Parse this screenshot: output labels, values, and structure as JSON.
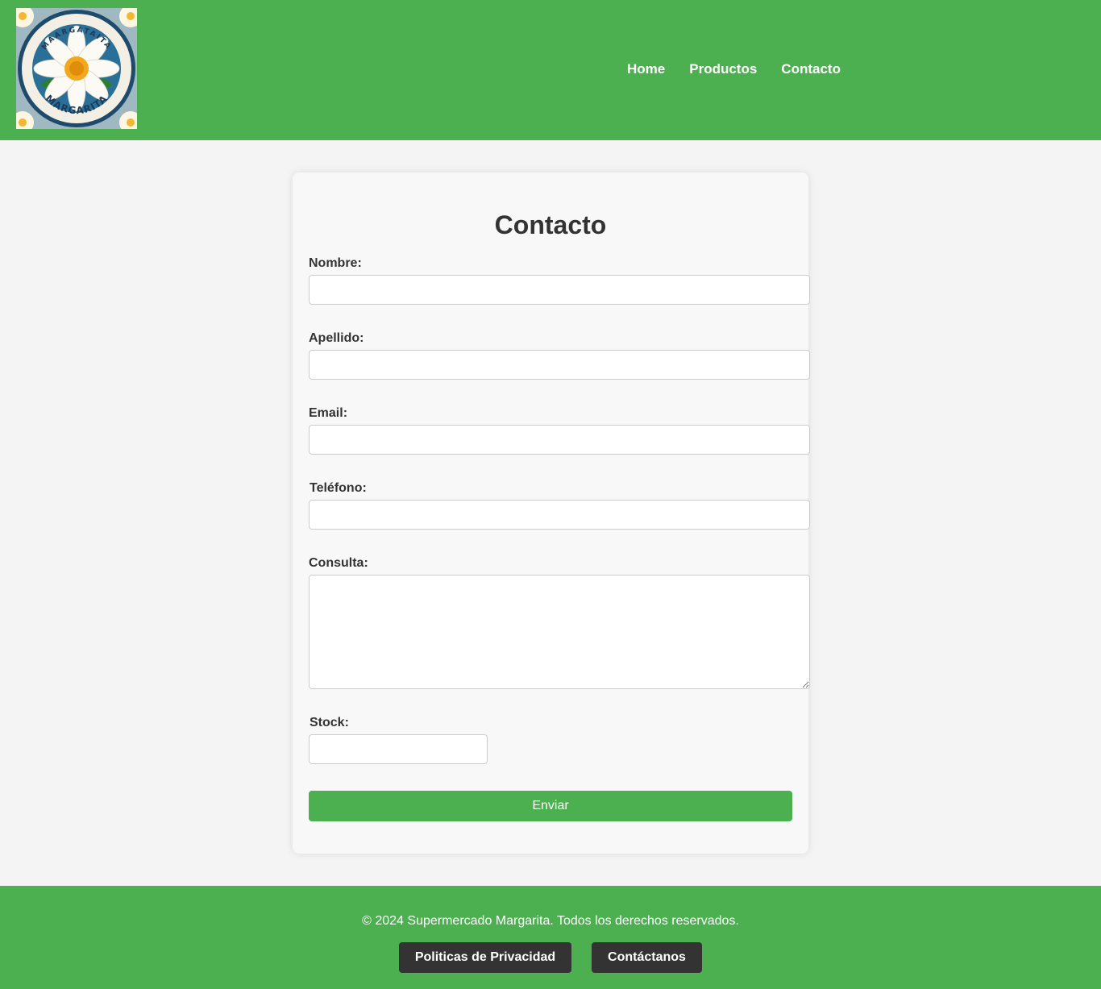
{
  "header": {
    "logo": {
      "top_text": "MAARGATAITA",
      "bottom_text": "MARGARITA"
    },
    "nav": [
      "Home",
      "Productos",
      "Contacto"
    ]
  },
  "form": {
    "title": "Contacto",
    "fields": {
      "nombre": "Nombre:",
      "apellido": "Apellido:",
      "email": "Email:",
      "telefono": "Teléfono:",
      "consulta": "Consulta:",
      "stock": "Stock:"
    },
    "submit": "Enviar"
  },
  "footer": {
    "copyright": "© 2024 Supermercado Margarita. Todos los derechos reservados.",
    "links": [
      "Politicas de Privacidad",
      "Contáctanos"
    ]
  },
  "colors": {
    "brand_green": "#4caf50",
    "dark_button": "#333333",
    "page_bg": "#f4f4f4",
    "card_bg": "#f8f8f8"
  }
}
